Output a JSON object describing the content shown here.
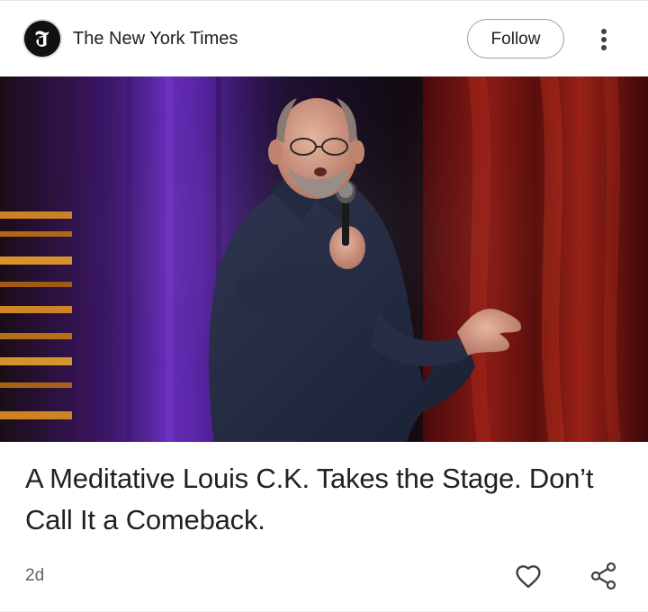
{
  "header": {
    "source_name": "The New York Times",
    "follow_label": "Follow",
    "logo_icon": "nyt-logo-icon",
    "more_icon": "more-vert-icon"
  },
  "hero_image": {
    "icon": "article-photo"
  },
  "article": {
    "headline": "A Meditative Louis C.K. Takes the Stage. Don’t Call It a Comeback.",
    "age": "2d"
  },
  "actions": {
    "like_icon": "heart-icon",
    "share_icon": "share-icon"
  },
  "colors": {
    "text_primary": "#202124",
    "text_secondary": "#5f6368",
    "button_border": "#9aa0a6"
  }
}
